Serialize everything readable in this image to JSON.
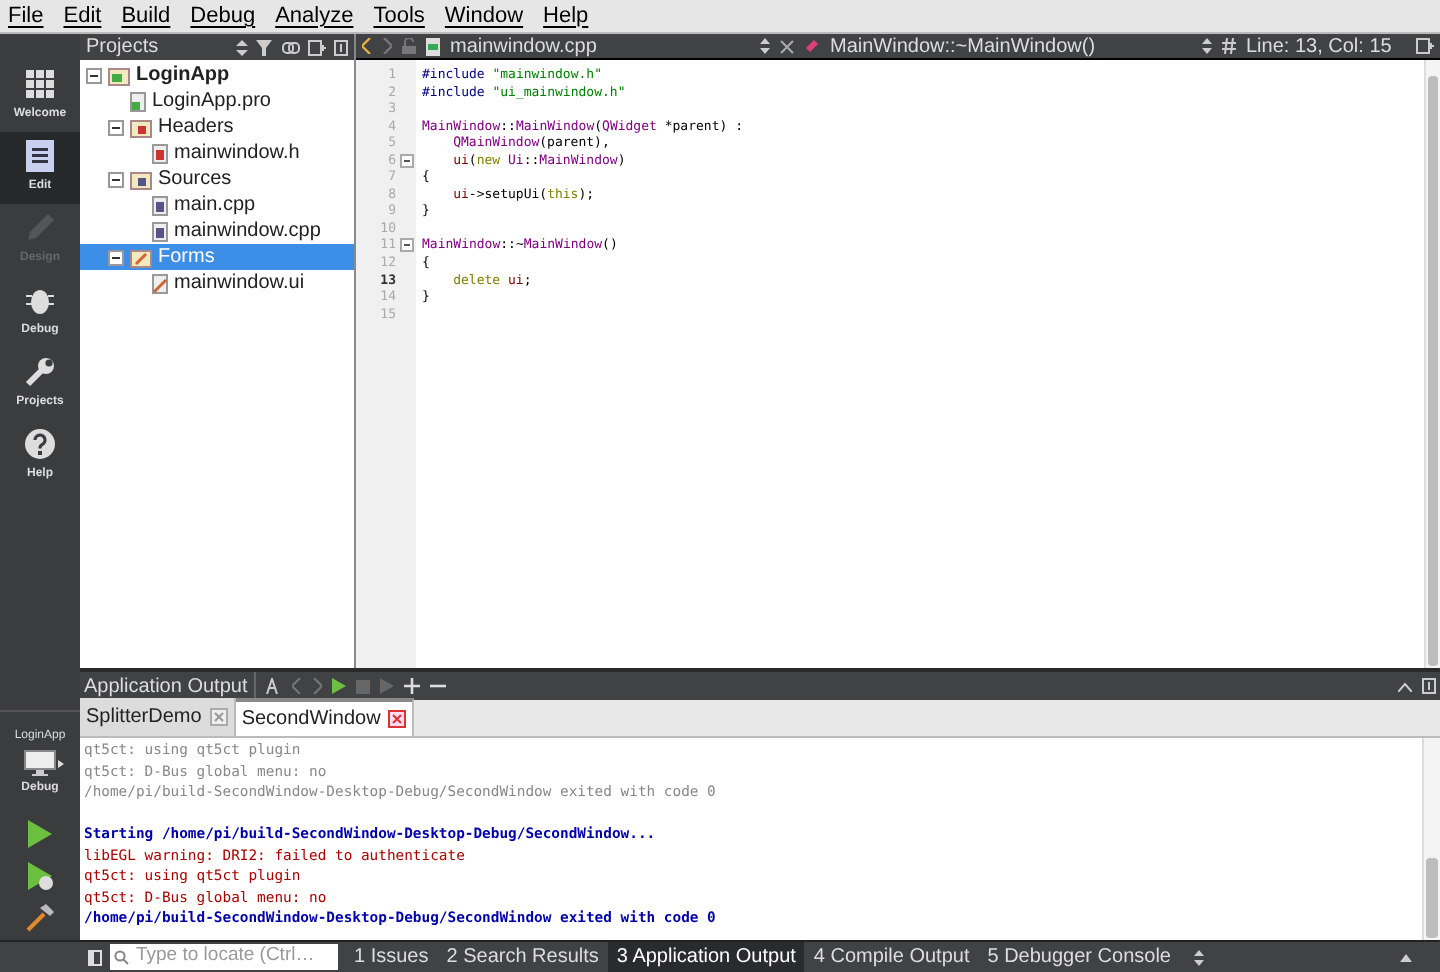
{
  "menu": [
    "File",
    "Edit",
    "Build",
    "Debug",
    "Analyze",
    "Tools",
    "Window",
    "Help"
  ],
  "modes": [
    {
      "label": "Welcome",
      "kind": "grid",
      "selected": false,
      "disabled": false
    },
    {
      "label": "Edit",
      "kind": "edit",
      "selected": true,
      "disabled": false
    },
    {
      "label": "Design",
      "kind": "design",
      "selected": false,
      "disabled": true
    },
    {
      "label": "Debug",
      "kind": "debug",
      "selected": false,
      "disabled": false
    },
    {
      "label": "Projects",
      "kind": "projects",
      "selected": false,
      "disabled": false
    },
    {
      "label": "Help",
      "kind": "help",
      "selected": false,
      "disabled": false
    }
  ],
  "kit": {
    "project": "LoginApp",
    "build": "Debug"
  },
  "projects_pane": {
    "title": "Projects",
    "tree": [
      {
        "label": "LoginApp",
        "kind": "project",
        "selected": false,
        "expanded": true,
        "children": [
          {
            "label": "LoginApp.pro",
            "kind": "pro",
            "selected": false
          },
          {
            "label": "Headers",
            "kind": "headers",
            "selected": false,
            "expanded": true,
            "children": [
              {
                "label": "mainwindow.h",
                "kind": "header",
                "selected": false
              }
            ]
          },
          {
            "label": "Sources",
            "kind": "sources",
            "selected": false,
            "expanded": true,
            "children": [
              {
                "label": "main.cpp",
                "kind": "source",
                "selected": false
              },
              {
                "label": "mainwindow.cpp",
                "kind": "source",
                "selected": false
              }
            ]
          },
          {
            "label": "Forms",
            "kind": "forms",
            "selected": true,
            "expanded": true,
            "children": [
              {
                "label": "mainwindow.ui",
                "kind": "form",
                "selected": false
              }
            ]
          }
        ]
      }
    ]
  },
  "editor": {
    "file": "mainwindow.cpp",
    "symbol": "MainWindow::~MainWindow()",
    "position": "Line: 13, Col: 15",
    "lines": [
      {
        "number": "1",
        "current": false,
        "fold": false,
        "indent": false,
        "tokens": [
          {
            "kind": "pre",
            "text": "#include"
          },
          {
            "kind": "str",
            "text": "\"mainwindow.h\""
          }
        ]
      },
      {
        "number": "2",
        "current": false,
        "fold": false,
        "indent": false,
        "tokens": [
          {
            "kind": "pre",
            "text": "#include"
          },
          {
            "kind": "str",
            "text": "\"ui_mainwindow.h\""
          }
        ]
      },
      {
        "number": "3",
        "current": false,
        "fold": false
      },
      {
        "number": "4",
        "current": false,
        "fold": false,
        "indent": false,
        "tokens": [
          {
            "kind": "type",
            "text": "MainWindow"
          },
          {
            "kind": "plain",
            "text": "::"
          },
          {
            "kind": "type",
            "text": "MainWindow"
          },
          {
            "kind": "plain",
            "text": "("
          },
          {
            "kind": "type",
            "text": "QWidget"
          },
          {
            "kind": "plain",
            "text": " *parent) :"
          }
        ]
      },
      {
        "number": "5",
        "current": false,
        "fold": false,
        "indent": true,
        "tokens": [
          {
            "kind": "type",
            "text": "QMainWindow"
          },
          {
            "kind": "plain",
            "text": "(parent),"
          }
        ]
      },
      {
        "number": "6",
        "current": false,
        "fold": true,
        "indent": true,
        "tokens": [
          {
            "kind": "field",
            "text": "ui"
          },
          {
            "kind": "plain",
            "text": "("
          },
          {
            "kind": "kw",
            "text": "new"
          },
          {
            "kind": "type",
            "text": " Ui"
          },
          {
            "kind": "plain",
            "text": "::"
          },
          {
            "kind": "type",
            "text": "MainWindow"
          },
          {
            "kind": "plain",
            "text": ")"
          }
        ]
      },
      {
        "number": "7",
        "current": false,
        "fold": false,
        "indent": false,
        "tokens": [
          {
            "kind": "plain",
            "text": "{"
          }
        ]
      },
      {
        "number": "8",
        "current": false,
        "fold": false,
        "indent": true,
        "tokens": [
          {
            "kind": "field",
            "text": "ui"
          },
          {
            "kind": "plain",
            "text": "->setupUi("
          },
          {
            "kind": "kw",
            "text": "this"
          },
          {
            "kind": "plain",
            "text": ");"
          }
        ]
      },
      {
        "number": "9",
        "current": false,
        "fold": false,
        "indent": false,
        "tokens": [
          {
            "kind": "plain",
            "text": "}"
          }
        ]
      },
      {
        "number": "10",
        "current": false,
        "fold": false
      },
      {
        "number": "11",
        "current": false,
        "fold": true,
        "indent": false,
        "tokens": [
          {
            "kind": "type",
            "text": "MainWindow"
          },
          {
            "kind": "plain",
            "text": "::~"
          },
          {
            "kind": "type",
            "text": "MainWindow"
          },
          {
            "kind": "plain",
            "text": "()"
          }
        ]
      },
      {
        "number": "12",
        "current": false,
        "fold": false,
        "indent": false,
        "tokens": [
          {
            "kind": "plain",
            "text": "{"
          }
        ]
      },
      {
        "number": "13",
        "current": true,
        "fold": false,
        "indent": true,
        "tokens": [
          {
            "kind": "kw",
            "text": "delete"
          },
          {
            "kind": "field",
            "text": " ui"
          },
          {
            "kind": "plain",
            "text": ";"
          }
        ]
      },
      {
        "number": "14",
        "current": false,
        "fold": false,
        "indent": false,
        "tokens": [
          {
            "kind": "plain",
            "text": "}"
          }
        ]
      },
      {
        "number": "15",
        "current": false,
        "fold": false
      }
    ]
  },
  "output_pane": {
    "title": "Application Output",
    "tabs": [
      {
        "label": "SplitterDemo",
        "selected": false
      },
      {
        "label": "SecondWindow",
        "selected": true
      }
    ],
    "lines": [
      {
        "kind": "old",
        "text": "qt5ct: using qt5ct plugin"
      },
      {
        "kind": "old",
        "text": "qt5ct: D-Bus global menu: no"
      },
      {
        "kind": "old",
        "text": "/home/pi/build-SecondWindow-Desktop-Debug/SecondWindow exited with code 0"
      },
      {
        "kind": "info",
        "text": "Starting /home/pi/build-SecondWindow-Desktop-Debug/SecondWindow...",
        "gap_before": true
      },
      {
        "kind": "err",
        "text": "libEGL warning: DRI2: failed to authenticate"
      },
      {
        "kind": "err",
        "text": "qt5ct: using qt5ct plugin"
      },
      {
        "kind": "err",
        "text": "qt5ct: D-Bus global menu: no"
      },
      {
        "kind": "info",
        "text": "/home/pi/build-SecondWindow-Desktop-Debug/SecondWindow exited with code 0"
      }
    ]
  },
  "locator": {
    "placeholder": "Type to locate (Ctrl…"
  },
  "bottom_tabs": [
    {
      "label": "1 Issues",
      "selected": false
    },
    {
      "label": "2 Search Results",
      "selected": false
    },
    {
      "label": "3 Application Output",
      "selected": true
    },
    {
      "label": "4 Compile Output",
      "selected": false
    },
    {
      "label": "5 Debugger Console",
      "selected": false
    }
  ]
}
